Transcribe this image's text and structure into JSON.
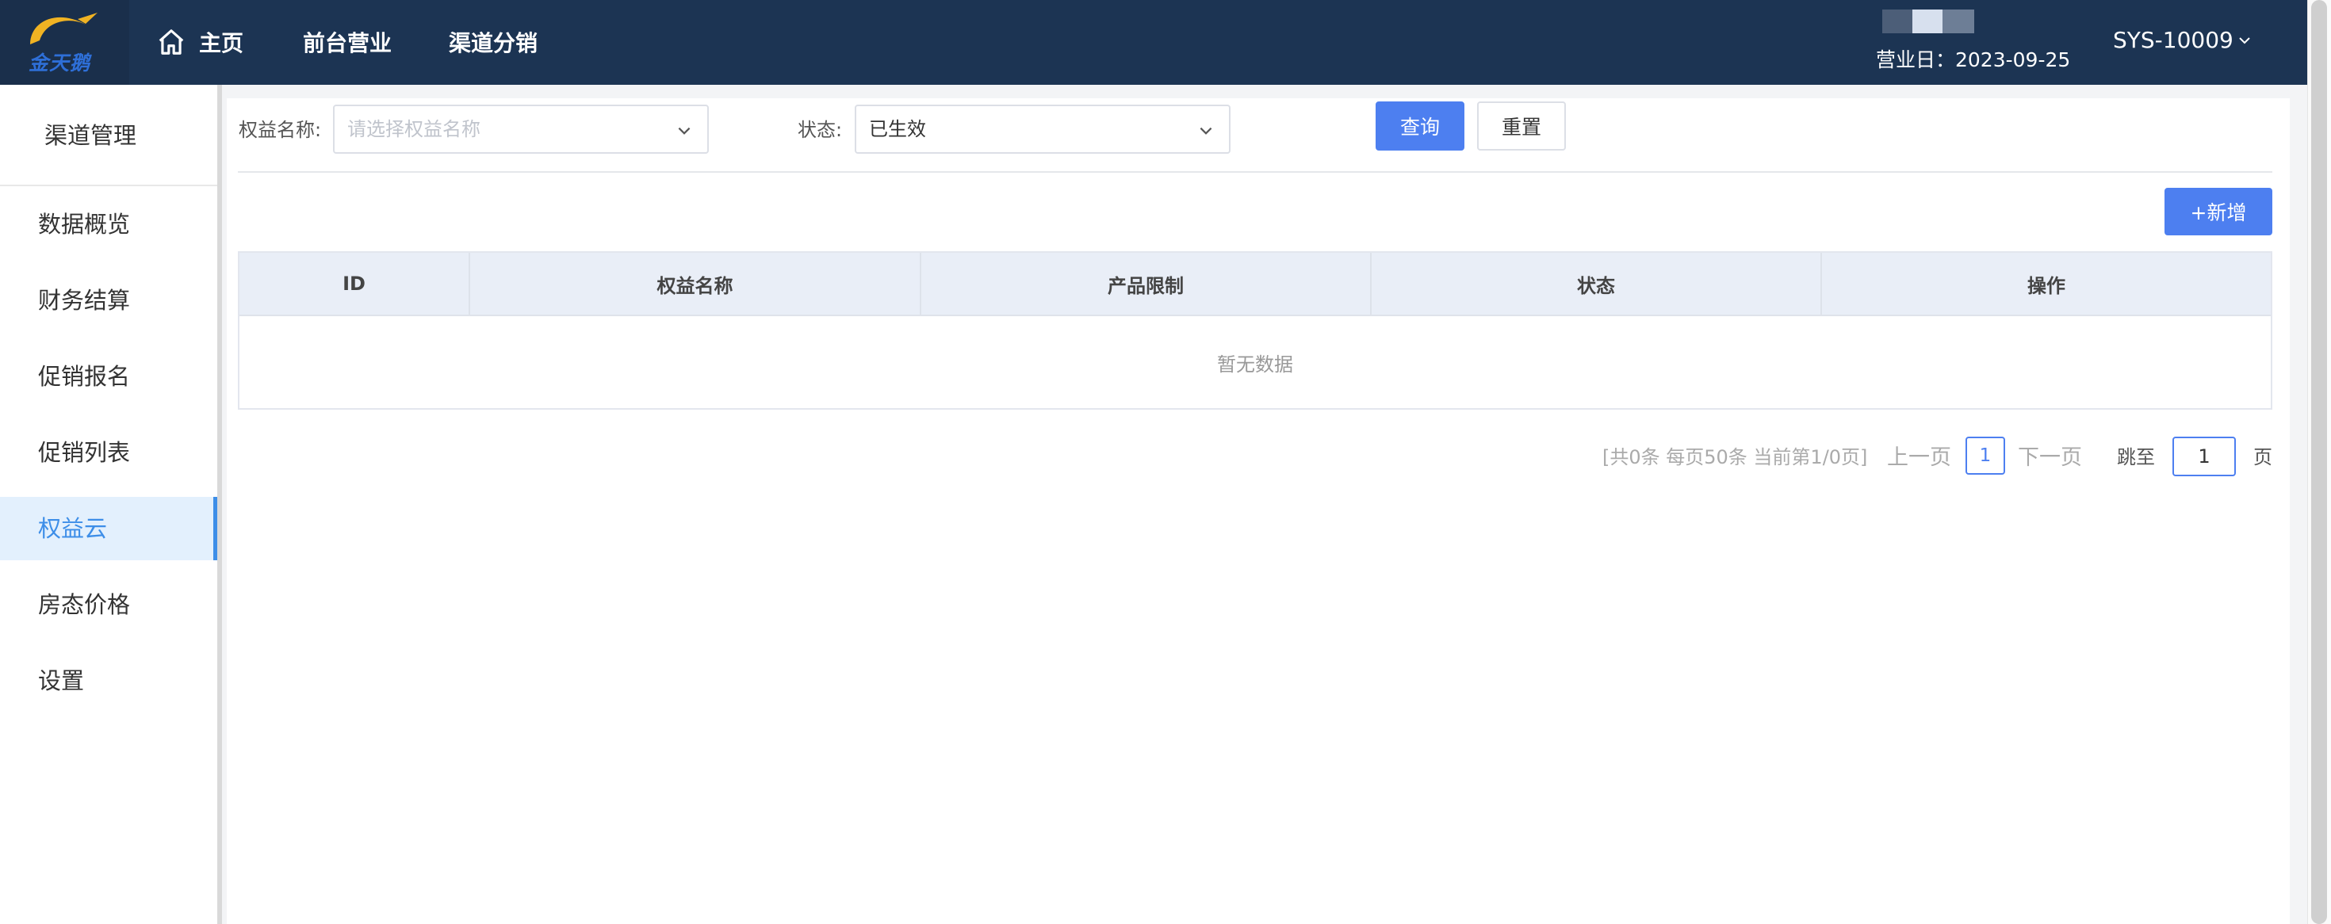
{
  "header": {
    "logo_text": "金天鹅",
    "nav": [
      {
        "label": "主页",
        "icon": "home-icon"
      },
      {
        "label": "前台营业"
      },
      {
        "label": "渠道分销"
      }
    ],
    "business_date": "营业日：2023-09-25",
    "user": "SYS-10009"
  },
  "sidebar": {
    "title": "渠道管理",
    "items": [
      {
        "label": "数据概览"
      },
      {
        "label": "财务结算"
      },
      {
        "label": "促销报名"
      },
      {
        "label": "促销列表"
      },
      {
        "label": "权益云",
        "active": true
      },
      {
        "label": "房态价格"
      },
      {
        "label": "设置"
      }
    ]
  },
  "filters": {
    "rights_name_label": "权益名称:",
    "rights_name_placeholder": "请选择权益名称",
    "status_label": "状态:",
    "status_value": "已生效",
    "query_button": "查询",
    "reset_button": "重置"
  },
  "toolbar": {
    "add_button": "+新增"
  },
  "table": {
    "columns": [
      "ID",
      "权益名称",
      "产品限制",
      "状态",
      "操作"
    ],
    "rows": [],
    "empty_text": "暂无数据"
  },
  "pagination": {
    "summary": "[共0条 每页50条 当前第1/0页]",
    "prev": "上一页",
    "current_page": "1",
    "next": "下一页",
    "jump_label": "跳至",
    "jump_value": "1",
    "page_suffix": "页"
  },
  "colors": {
    "topbar": "#1c3453",
    "primary": "#4d7ff0",
    "active_menu_bg": "#e3f0fd",
    "active_menu_text": "#3d8ee8"
  }
}
